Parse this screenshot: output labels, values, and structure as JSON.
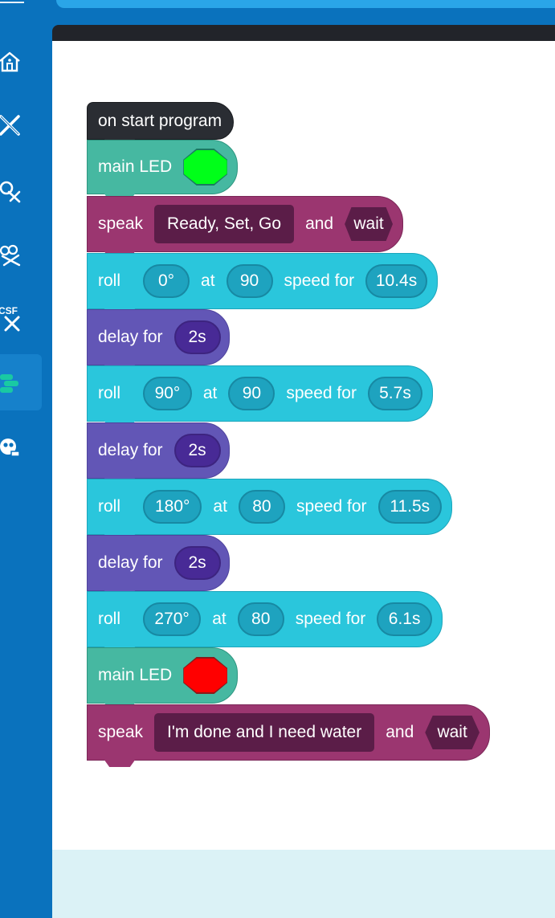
{
  "sidebar": {
    "items": [
      {
        "icon": "home-icon"
      },
      {
        "icon": "tools-icon"
      },
      {
        "icon": "search-tools-icon"
      },
      {
        "icon": "group-tools-icon"
      },
      {
        "icon": "csf-tools-icon",
        "label": "CSF"
      },
      {
        "icon": "block-code-icon"
      },
      {
        "icon": "robot-chat-icon"
      }
    ],
    "active_index": 5
  },
  "program": {
    "start": {
      "label": "on start program"
    },
    "led1": {
      "label": "main LED",
      "color": "#00ff19"
    },
    "speak1": {
      "label": "speak",
      "text": "Ready, Set, Go",
      "and": "and",
      "wait": "wait"
    },
    "roll1": {
      "label": "roll",
      "heading": "0°",
      "at": "at",
      "speed": "90",
      "speed_for": "speed for",
      "duration": "10.4s"
    },
    "delay1": {
      "label": "delay for",
      "value": "2s"
    },
    "roll2": {
      "label": "roll",
      "heading": "90°",
      "at": "at",
      "speed": "90",
      "speed_for": "speed for",
      "duration": "5.7s"
    },
    "delay2": {
      "label": "delay for",
      "value": "2s"
    },
    "roll3": {
      "label": "roll",
      "heading": "180°",
      "at": "at",
      "speed": "80",
      "speed_for": "speed for",
      "duration": "11.5s"
    },
    "delay3": {
      "label": "delay for",
      "value": "2s"
    },
    "roll4": {
      "label": "roll",
      "heading": "270°",
      "at": "at",
      "speed": "80",
      "speed_for": "speed for",
      "duration": "6.1s"
    },
    "led2": {
      "label": "main LED",
      "color": "#ff0000"
    },
    "speak2": {
      "label": "speak",
      "text": "I'm done and I need water",
      "and": "and",
      "wait": "wait"
    }
  },
  "colors": {
    "sidebar": "#0a72bd",
    "hat": "#2a2d33",
    "led": "#46b8a1",
    "speak": "#9b3670",
    "roll": "#2ac6dc",
    "delay": "#6256b6"
  }
}
